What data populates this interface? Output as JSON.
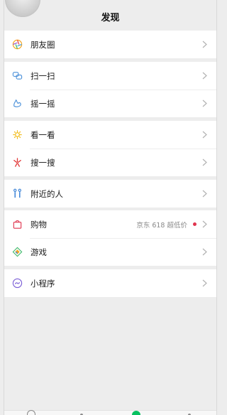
{
  "header": {
    "title": "发现"
  },
  "groups": [
    {
      "items": [
        {
          "label": "朋友圈",
          "icon": "moments-icon"
        }
      ]
    },
    {
      "items": [
        {
          "label": "扫一扫",
          "icon": "scan-icon"
        },
        {
          "label": "摇一摇",
          "icon": "shake-icon"
        }
      ]
    },
    {
      "items": [
        {
          "label": "看一看",
          "icon": "top-stories-icon"
        },
        {
          "label": "搜一搜",
          "icon": "search-icon"
        }
      ]
    },
    {
      "items": [
        {
          "label": "附近的人",
          "icon": "people-nearby-icon"
        }
      ]
    },
    {
      "items": [
        {
          "label": "购物",
          "icon": "shopping-bag-icon",
          "extra": "京东 618 超低价",
          "badge_color": "#e0344e"
        },
        {
          "label": "游戏",
          "icon": "games-icon"
        }
      ]
    },
    {
      "items": [
        {
          "label": "小程序",
          "icon": "mini-programs-icon"
        }
      ]
    }
  ],
  "colors": {
    "background": "#ededed",
    "cell": "#ffffff",
    "chevron": "#b2b2b2",
    "tab_active": "#07c160"
  }
}
